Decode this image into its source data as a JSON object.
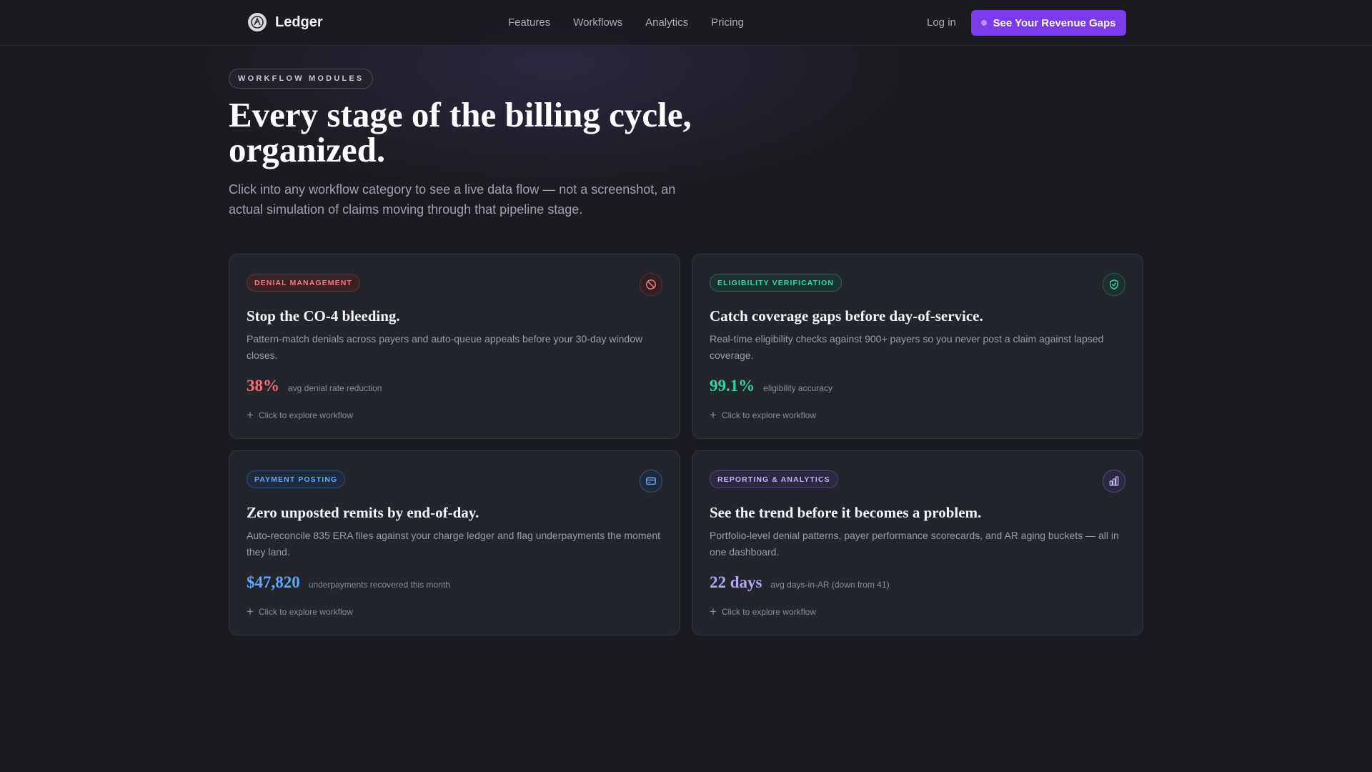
{
  "nav": {
    "brand": "Ledger",
    "links": [
      "Features",
      "Workflows",
      "Analytics",
      "Pricing"
    ],
    "login": "Log in",
    "cta": "See Your Revenue Gaps"
  },
  "hero": {
    "pill": "WORKFLOW MODULES",
    "title": "Every stage of the billing cycle, organized.",
    "subtitle": "Click into any workflow category to see a live data flow — not a screenshot, an actual simulation of claims moving through that pipeline stage."
  },
  "colors": {
    "accent": "#7c3aed",
    "denial": "#ef6f79",
    "eligibility": "#34d399",
    "payment": "#60a5fa",
    "reporting": "#b7a6f5"
  },
  "cards": [
    {
      "tag": "DENIAL MANAGEMENT",
      "icon": "prohibited-icon",
      "title": "Stop the CO-4 bleeding.",
      "description": "Pattern-match denials across payers and auto-queue appeals before your 30-day window closes.",
      "metric_value": "38%",
      "metric_label": "avg denial rate reduction",
      "explore": "Click to explore workflow"
    },
    {
      "tag": "ELIGIBILITY VERIFICATION",
      "icon": "shield-check-icon",
      "title": "Catch coverage gaps before day-of-service.",
      "description": "Real-time eligibility checks against 900+ payers so you never post a claim against lapsed coverage.",
      "metric_value": "99.1%",
      "metric_label": "eligibility accuracy",
      "explore": "Click to explore workflow"
    },
    {
      "tag": "PAYMENT POSTING",
      "icon": "credit-card-icon",
      "title": "Zero unposted remits by end-of-day.",
      "description": "Auto-reconcile 835 ERA files against your charge ledger and flag underpayments the moment they land.",
      "metric_value": "$47,820",
      "metric_label": "underpayments recovered this month",
      "explore": "Click to explore workflow"
    },
    {
      "tag": "REPORTING & ANALYTICS",
      "icon": "bar-chart-icon",
      "title": "See the trend before it becomes a problem.",
      "description": "Portfolio-level denial patterns, payer performance scorecards, and AR aging buckets — all in one dashboard.",
      "metric_value": "22 days",
      "metric_label": "avg days-in-AR (down from 41)",
      "explore": "Click to explore workflow"
    }
  ]
}
